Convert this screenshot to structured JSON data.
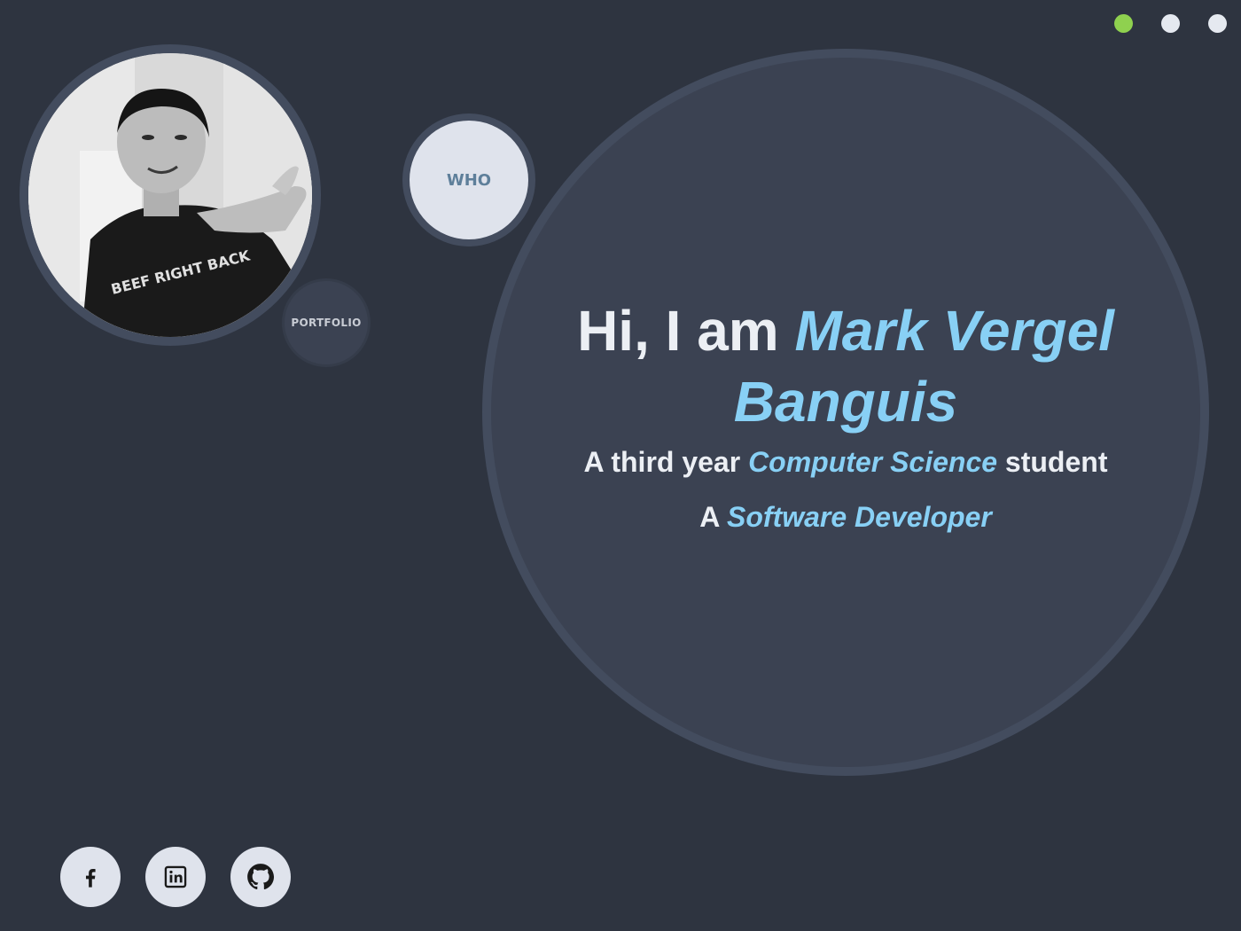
{
  "nav": {
    "dots": [
      {
        "state": "active",
        "color": "#8fd14f"
      },
      {
        "state": "inactive",
        "color": "#e5e9f0"
      },
      {
        "state": "inactive",
        "color": "#e5e9f0"
      }
    ]
  },
  "profile": {
    "photo_shirt_text": "BEEF RIGHT BACK"
  },
  "bubbles": {
    "portfolio_label": "PORTFOLIO",
    "who_label": "WHO"
  },
  "intro": {
    "greeting": "Hi, I am ",
    "name": "Mark Vergel Banguis",
    "line1_prefix": "A third year ",
    "line1_field": "Computer Science",
    "line1_suffix": " student",
    "line2_prefix": "A ",
    "line2_role": "Software Developer"
  },
  "socials": [
    {
      "name": "facebook-icon"
    },
    {
      "name": "linkedin-icon"
    },
    {
      "name": "github-icon"
    }
  ],
  "colors": {
    "background": "#2e3440",
    "accent": "#88d0f5",
    "active_dot": "#8fd14f"
  }
}
